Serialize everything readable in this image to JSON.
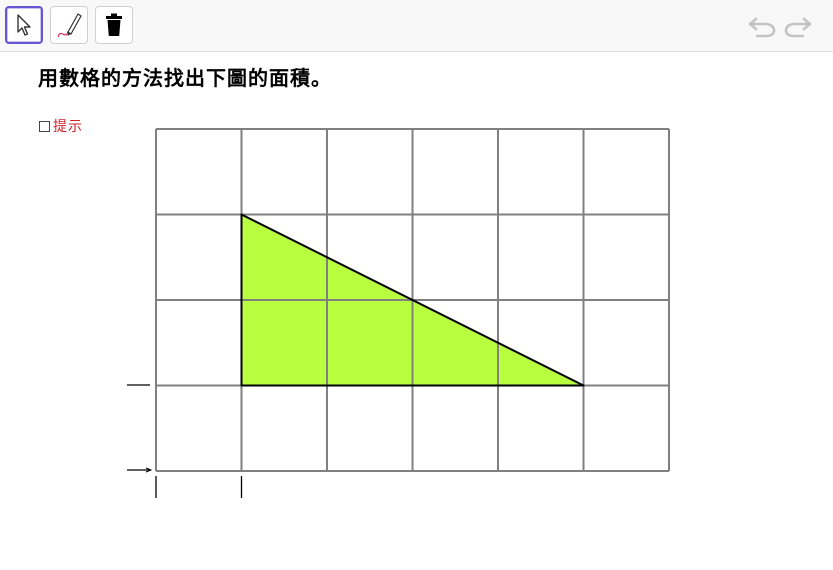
{
  "toolbar": {
    "tools": [
      {
        "name": "move-tool",
        "icon": "cursor-arrow-icon",
        "selected": true
      },
      {
        "name": "pen-tool",
        "icon": "pen-icon",
        "selected": false
      },
      {
        "name": "delete-tool",
        "icon": "trash-icon",
        "selected": false
      }
    ],
    "undo_icon": "undo-icon",
    "redo_icon": "redo-icon"
  },
  "instruction": "用數格的方法找出下圖的面積。",
  "hint": {
    "label": "提示",
    "checked": false,
    "color": "#d0202a"
  },
  "grid": {
    "columns": 6,
    "rows": 4,
    "line_color": "#808080"
  },
  "triangle": {
    "vertices": [
      [
        1,
        1
      ],
      [
        1,
        3
      ],
      [
        5,
        3
      ]
    ],
    "fill": "#b8ff40",
    "stroke": "#000000"
  }
}
